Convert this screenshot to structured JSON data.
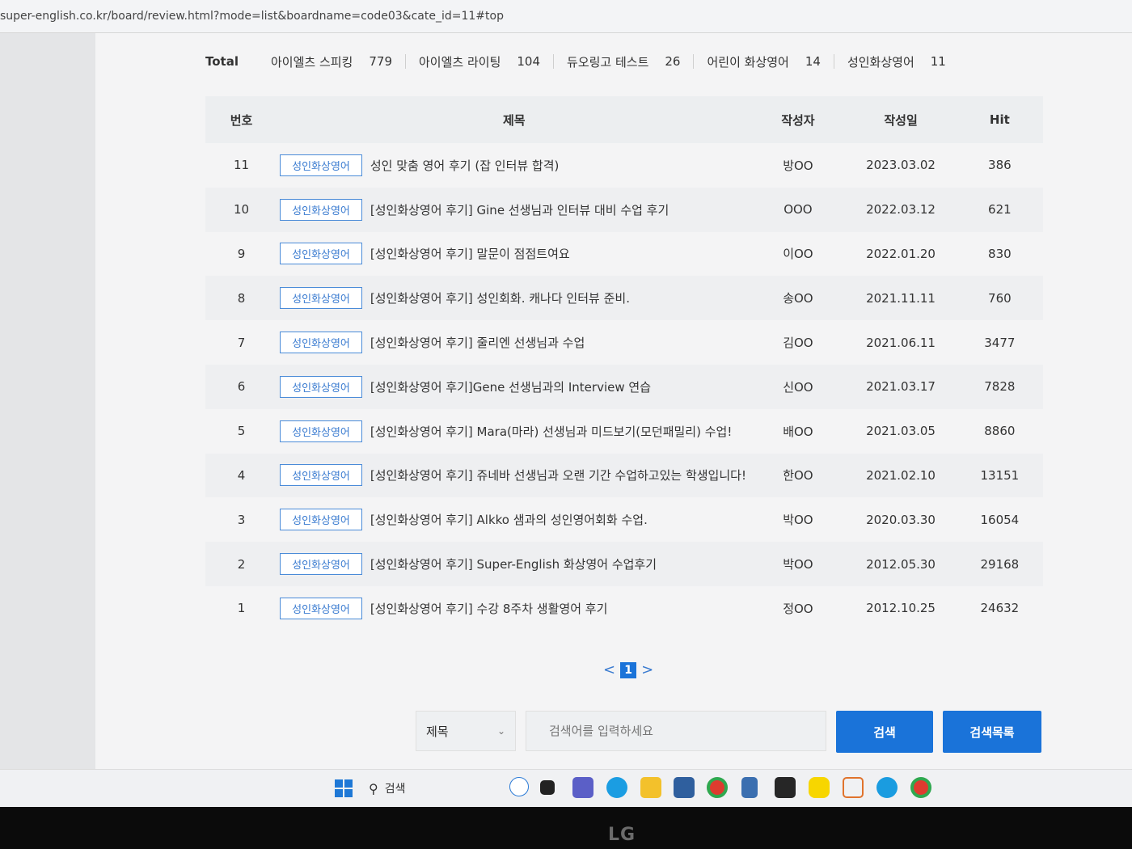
{
  "browser": {
    "url": "super-english.co.kr/board/review.html?mode=list&boardname=code03&cate_id=11#top"
  },
  "categories": {
    "total_label": "Total",
    "items": [
      {
        "label": "아이엘츠 스피킹",
        "count": "779"
      },
      {
        "label": "아이엘츠 라이팅",
        "count": "104"
      },
      {
        "label": "듀오링고 테스트",
        "count": "26"
      },
      {
        "label": "어린이 화상영어",
        "count": "14"
      },
      {
        "label": "성인화상영어",
        "count": "11"
      }
    ]
  },
  "table": {
    "headers": {
      "num": "번호",
      "title": "제목",
      "author": "작성자",
      "date": "작성일",
      "hit": "Hit"
    },
    "rows": [
      {
        "num": "11",
        "badge": "성인화상영어",
        "title": "성인 맞춤 영어 후기 (잡 인터뷰 합격)",
        "author": "방OO",
        "date": "2023.03.02",
        "hit": "386"
      },
      {
        "num": "10",
        "badge": "성인화상영어",
        "title": "[성인화상영어 후기] Gine 선생님과 인터뷰 대비 수업 후기",
        "author": "OOO",
        "date": "2022.03.12",
        "hit": "621"
      },
      {
        "num": "9",
        "badge": "성인화상영어",
        "title": "[성인화상영어 후기] 말문이 점점트여요",
        "author": "이OO",
        "date": "2022.01.20",
        "hit": "830"
      },
      {
        "num": "8",
        "badge": "성인화상영어",
        "title": "[성인화상영어 후기] 성인회화. 캐나다 인터뷰 준비.",
        "author": "송OO",
        "date": "2021.11.11",
        "hit": "760"
      },
      {
        "num": "7",
        "badge": "성인화상영어",
        "title": "[성인화상영어 후기] 줄리엔 선생님과 수업",
        "author": "김OO",
        "date": "2021.06.11",
        "hit": "3477"
      },
      {
        "num": "6",
        "badge": "성인화상영어",
        "title": "[성인화상영어 후기]Gene 선생님과의 Interview 연습",
        "author": "신OO",
        "date": "2021.03.17",
        "hit": "7828"
      },
      {
        "num": "5",
        "badge": "성인화상영어",
        "title": "[성인화상영어 후기] Mara(마라) 선생님과 미드보기(모던패밀리) 수업!",
        "author": "배OO",
        "date": "2021.03.05",
        "hit": "8860"
      },
      {
        "num": "4",
        "badge": "성인화상영어",
        "title": "[성인화상영어 후기] 쥬네바 선생님과 오랜 기간 수업하고있는 학생입니다!",
        "author": "한OO",
        "date": "2021.02.10",
        "hit": "13151"
      },
      {
        "num": "3",
        "badge": "성인화상영어",
        "title": "[성인화상영어 후기] Alkko 샘과의 성인영어회화 수업.",
        "author": "박OO",
        "date": "2020.03.30",
        "hit": "16054"
      },
      {
        "num": "2",
        "badge": "성인화상영어",
        "title": "[성인화상영어 후기] Super-English 화상영어 수업후기",
        "author": "박OO",
        "date": "2012.05.30",
        "hit": "29168"
      },
      {
        "num": "1",
        "badge": "성인화상영어",
        "title": "[성인화상영어 후기] 수강 8주차 생활영어 후기",
        "author": "정OO",
        "date": "2012.10.25",
        "hit": "24632"
      }
    ]
  },
  "pagination": {
    "prev": "<",
    "current": "1",
    "next": ">"
  },
  "search": {
    "field_value": "제목",
    "placeholder": "검색어를 입력하세요",
    "search_button": "검색",
    "list_button": "검색목록"
  },
  "taskbar": {
    "search_label": "검색",
    "icons": [
      "windows-start-icon",
      "bing-icon",
      "task-view-icon",
      "teams-chat-icon",
      "edge-icon",
      "file-explorer-icon",
      "mail-icon",
      "chrome-icon",
      "notepad-icon",
      "sticky-notes-icon",
      "kakaotalk-icon",
      "snipping-tool-icon",
      "skype-icon",
      "chrome-profile-icon"
    ]
  },
  "monitor": {
    "brand": "LG"
  }
}
